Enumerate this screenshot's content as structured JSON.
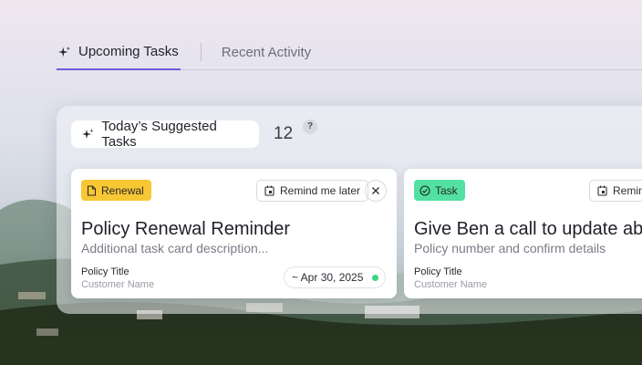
{
  "tabs": [
    {
      "label": "Upcoming Tasks",
      "active": true,
      "icon": "sparkle-icon"
    },
    {
      "label": "Recent Activity",
      "active": false
    }
  ],
  "suggested": {
    "label": "Today’s Suggested Tasks",
    "count": "12",
    "help": "?"
  },
  "cards": [
    {
      "badge": "Renewal",
      "badge_color": "#f7c734",
      "remind_label": "Remind me later",
      "title": "Policy Renewal Reminder",
      "description": "Additional task card description...",
      "policy_title": "Policy Title",
      "customer": "Customer Name",
      "date": "~ Apr 30, 2025",
      "status_color": "#3ed67f"
    },
    {
      "badge": "Task",
      "badge_color": "#53e0a0",
      "remind_label": "Remind me later",
      "title": "Give Ben a call to update ab",
      "description": "Policy number and confirm details",
      "policy_title": "Policy Title",
      "customer": "Customer Name"
    }
  ]
}
